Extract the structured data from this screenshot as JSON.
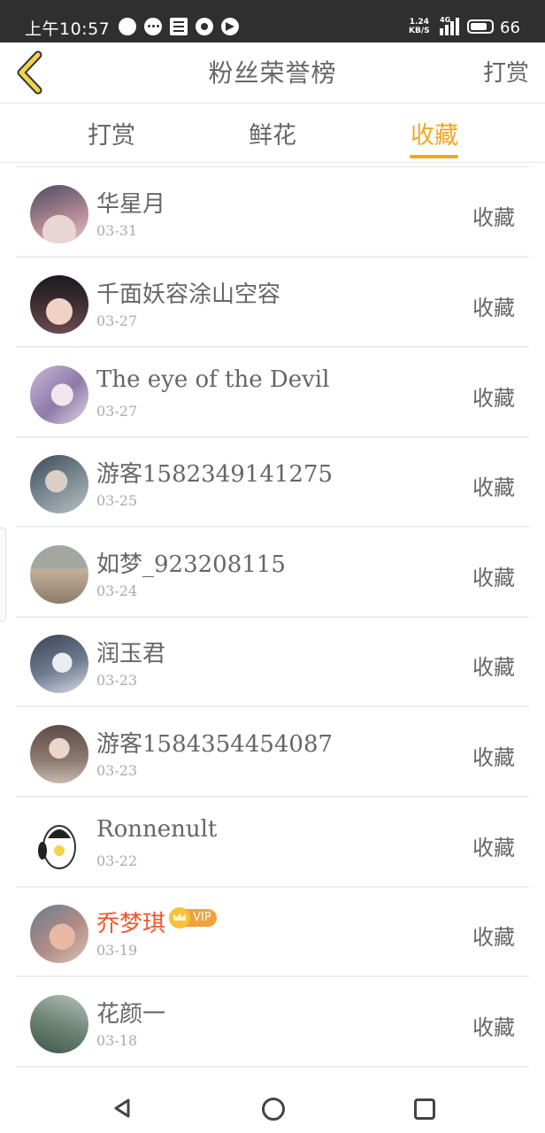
{
  "status_bar": {
    "time": "上午10:57",
    "speed_top": "1.24",
    "speed_bottom": "KB/S",
    "network": "4G",
    "battery": "66"
  },
  "header": {
    "title": "粉丝荣誉榜",
    "action": "打赏",
    "back_icon": "chevron-left-icon"
  },
  "tabs": [
    {
      "label": "打赏",
      "active": false
    },
    {
      "label": "鲜花",
      "active": false
    },
    {
      "label": "收藏",
      "active": true
    }
  ],
  "accent_color": "#f5a623",
  "vip_name_color": "#f2552c",
  "fans": [
    {
      "name": "华星月",
      "date": "03-31",
      "action": "收藏"
    },
    {
      "name": "千面妖容涂山空容",
      "date": "03-27",
      "action": "收藏"
    },
    {
      "name": "The eye of the Devil",
      "date": "03-27",
      "action": "收藏"
    },
    {
      "name": "游客1582349141275",
      "date": "03-25",
      "action": "收藏"
    },
    {
      "name": "如梦_923208115",
      "date": "03-24",
      "action": "收藏"
    },
    {
      "name": "润玉君",
      "date": "03-23",
      "action": "收藏"
    },
    {
      "name": "游客1584354454087",
      "date": "03-23",
      "action": "收藏"
    },
    {
      "name": "Ronnenult",
      "date": "03-22",
      "action": "收藏"
    },
    {
      "name": "乔梦琪",
      "date": "03-19",
      "action": "收藏",
      "vip": true,
      "vip_label": "VIP"
    },
    {
      "name": "花颜一",
      "date": "03-18",
      "action": "收藏"
    }
  ]
}
